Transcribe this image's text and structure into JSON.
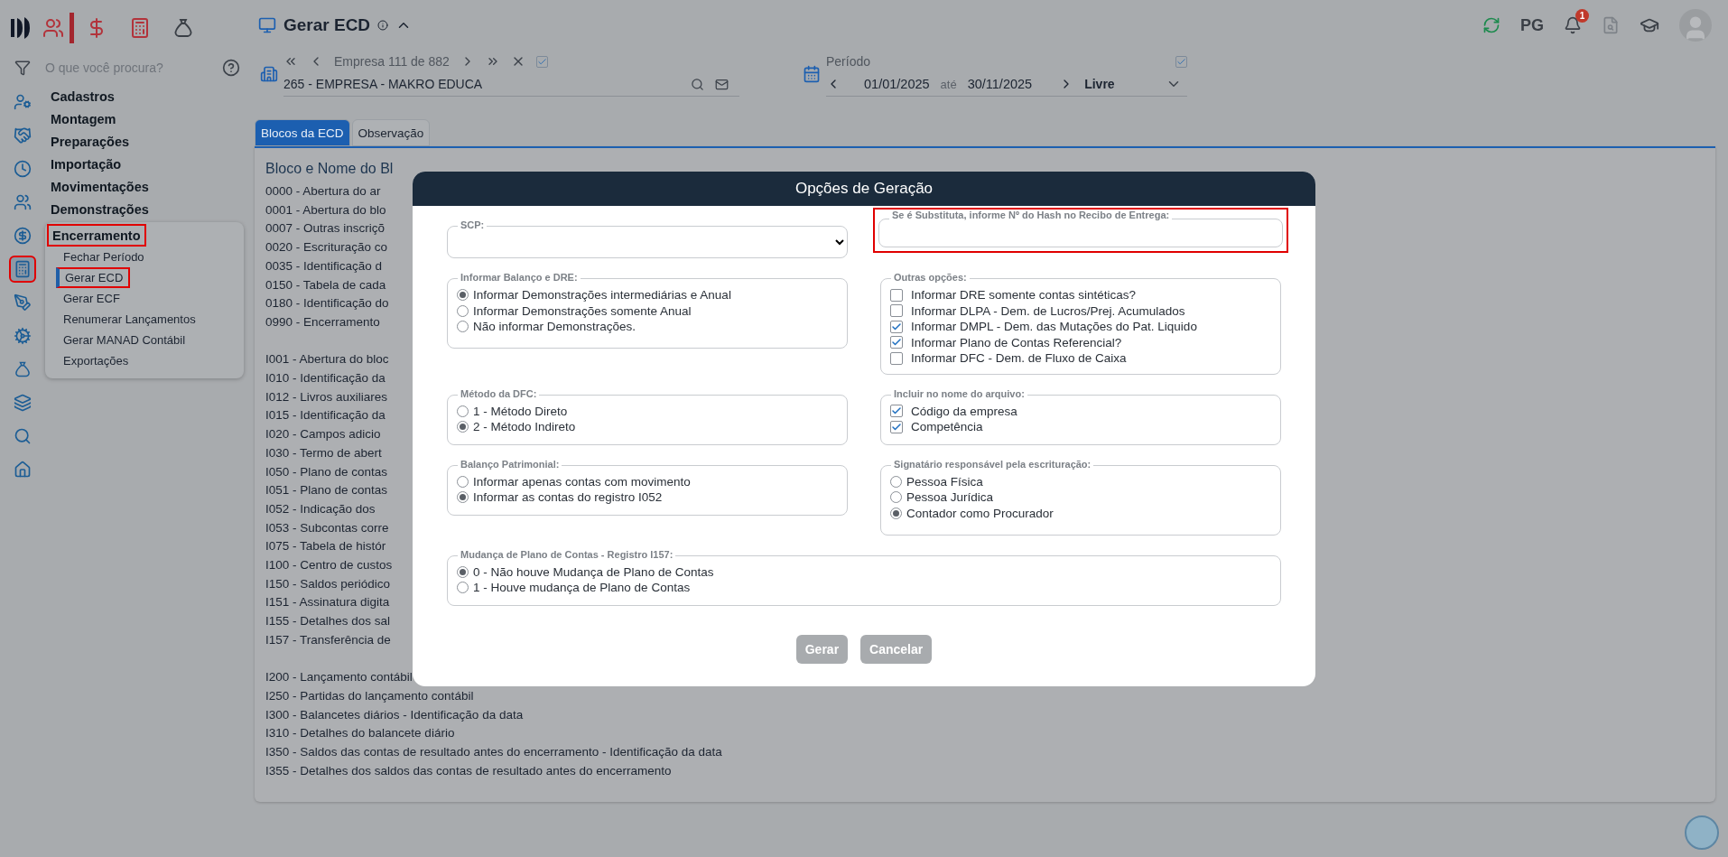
{
  "modules": [
    {
      "kind": "people",
      "selected": true
    },
    {
      "kind": "dollar",
      "selected": false
    },
    {
      "kind": "calculator",
      "selected": false
    },
    {
      "kind": "bag",
      "selected": false
    }
  ],
  "header": {
    "title": "Gerar ECD",
    "user_initials": "PG",
    "notification_count": "1"
  },
  "sidebar": {
    "search_placeholder": "O que você procura?",
    "rail": [
      {
        "kind": "user-gear",
        "highlighted": false
      },
      {
        "kind": "handshake",
        "highlighted": false
      },
      {
        "kind": "clock",
        "highlighted": false
      },
      {
        "kind": "users",
        "highlighted": false
      },
      {
        "kind": "dollar",
        "highlighted": false
      },
      {
        "kind": "calculator",
        "highlighted": true
      },
      {
        "kind": "pen",
        "highlighted": false
      },
      {
        "kind": "cog",
        "highlighted": false
      },
      {
        "kind": "bag",
        "highlighted": false
      },
      {
        "kind": "layers",
        "highlighted": false
      },
      {
        "kind": "search",
        "highlighted": false
      },
      {
        "kind": "home",
        "highlighted": false
      }
    ],
    "sections": [
      {
        "label": "Cadastros",
        "expanded": false,
        "highlighted": false
      },
      {
        "label": "Montagem",
        "expanded": false,
        "highlighted": false
      },
      {
        "label": "Preparações",
        "expanded": false,
        "highlighted": false
      },
      {
        "label": "Importação",
        "expanded": false,
        "highlighted": false
      },
      {
        "label": "Movimentações",
        "expanded": false,
        "highlighted": false
      },
      {
        "label": "Demonstrações",
        "expanded": false,
        "highlighted": false
      },
      {
        "label": "Encerramento",
        "expanded": true,
        "highlighted": true,
        "children": [
          {
            "label": "Fechar Período",
            "selected": false,
            "highlighted": false
          },
          {
            "label": "Gerar ECD",
            "selected": true,
            "highlighted": true
          },
          {
            "label": "Gerar ECF",
            "selected": false,
            "highlighted": false
          },
          {
            "label": "Renumerar Lançamentos",
            "selected": false,
            "highlighted": false
          },
          {
            "label": "Gerar MANAD Contábil",
            "selected": false,
            "highlighted": false
          },
          {
            "label": "Exportações",
            "selected": false,
            "highlighted": false
          }
        ]
      }
    ]
  },
  "company": {
    "label": "Empresa 111 de 882",
    "checked": true,
    "name": "265 - EMPRESA - MAKRO EDUCA"
  },
  "period": {
    "label": "Período",
    "checked": true,
    "start": "01/01/2025",
    "separator": "até",
    "end": "30/11/2025",
    "mode": "Livre"
  },
  "tabs": [
    {
      "label": "Blocos da ECD",
      "selected": true
    },
    {
      "label": "Observação",
      "selected": false
    }
  ],
  "blocks": {
    "title": "Bloco e Nome do Bl",
    "groups": [
      [
        "0000 - Abertura do ar",
        "0001 - Abertura do blo",
        "0007 - Outras inscriçõ",
        "0020 - Escrituração co",
        "0035 - Identificação d",
        "0150 - Tabela de cada",
        "0180 - Identificação do",
        "0990 - Encerramento"
      ],
      [
        "I001 - Abertura do bloc",
        "I010 - Identificação da",
        "I012 - Livros auxiliares",
        "I015 - Identificação da",
        "I020 - Campos adicio",
        "I030 - Termo de abert",
        "I050 - Plano de contas",
        "I051 - Plano de contas",
        "I052 - Indicação dos",
        "I053 - Subcontas corre",
        "I075 - Tabela de histór",
        "I100 - Centro de custos",
        "I150 - Saldos periódico",
        "I151 - Assinatura digita",
        "I155 - Detalhes dos sal",
        "I157 - Transferência de"
      ],
      [
        "I200 - Lançamento contábil",
        "I250 - Partidas do lançamento contábil",
        "I300 - Balancetes diários - Identificação da data",
        "I310 - Detalhes do balancete diário",
        "I350 - Saldos das contas de resultado antes do encerramento - Identificação da data",
        "I355 - Detalhes dos saldos das contas de resultado antes do encerramento"
      ]
    ]
  },
  "dialog": {
    "title": "Opções de Geração",
    "scp": {
      "legend": "SCP:"
    },
    "hash": {
      "legend": "Se é Substituta, informe Nº do Hash no Recibo de Entrega:",
      "highlighted": true
    },
    "groups": [
      {
        "legend": "Informar Balanço e DRE:",
        "kind": "radio",
        "wide": false,
        "options": [
          {
            "label": "Informar Demonstrações intermediárias e Anual",
            "selected": true
          },
          {
            "label": "Informar Demonstrações somente Anual",
            "selected": false
          },
          {
            "label": "Não informar Demonstrações.",
            "selected": false
          }
        ]
      },
      {
        "legend": "Outras opções:",
        "kind": "checkbox",
        "wide": false,
        "options": [
          {
            "label": "Informar DRE somente contas sintéticas?",
            "checked": false
          },
          {
            "label": "Informar DLPA - Dem. de Lucros/Prej. Acumulados",
            "checked": false
          },
          {
            "label": "Informar DMPL - Dem. das Mutações do Pat. Liquido",
            "checked": true
          },
          {
            "label": "Informar Plano de Contas Referencial?",
            "checked": true
          },
          {
            "label": "Informar DFC - Dem. de Fluxo de Caixa",
            "checked": false
          }
        ]
      },
      {
        "legend": "Método da DFC:",
        "kind": "radio",
        "wide": false,
        "options": [
          {
            "label": "1 - Método Direto",
            "selected": false
          },
          {
            "label": "2 - Método Indireto",
            "selected": true
          }
        ]
      },
      {
        "legend": "Incluir no nome do arquivo:",
        "kind": "checkbox",
        "wide": false,
        "options": [
          {
            "label": "Código da empresa",
            "checked": true
          },
          {
            "label": "Competência",
            "checked": true
          }
        ]
      },
      {
        "legend": "Balanço Patrimonial:",
        "kind": "radio",
        "wide": false,
        "options": [
          {
            "label": "Informar apenas contas com movimento",
            "selected": false
          },
          {
            "label": "Informar as contas do registro I052",
            "selected": true
          }
        ]
      },
      {
        "legend": "Signatário responsável pela escrituração:",
        "kind": "radio",
        "wide": false,
        "options": [
          {
            "label": "Pessoa Física",
            "selected": false
          },
          {
            "label": "Pessoa Jurídica",
            "selected": false
          },
          {
            "label": "Contador como Procurador",
            "selected": true
          }
        ]
      },
      {
        "legend": "Mudança de Plano de Contas - Registro I157:",
        "kind": "radio",
        "wide": true,
        "options": [
          {
            "label": "0 - Não houve Mudança de Plano de Contas",
            "selected": true
          },
          {
            "label": "1 - Houve mudança de Plano de Contas",
            "selected": false
          }
        ]
      }
    ],
    "buttons": [
      "Gerar",
      "Cancelar"
    ]
  }
}
